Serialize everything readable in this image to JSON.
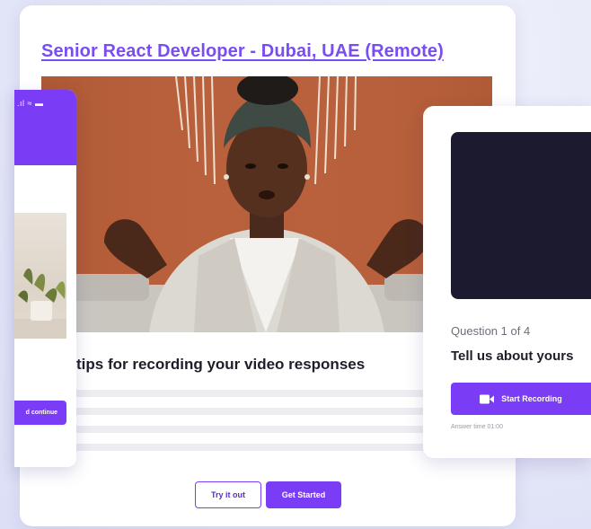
{
  "main_card": {
    "job_title": "Senior React Developer - Dubai, UAE (Remote)",
    "tips_title": "tips for recording your video responses",
    "try_button": "Try it out",
    "start_button": "Get Started"
  },
  "phone_card": {
    "status": ".ıl ≈ ▬",
    "continue_button": "d continue"
  },
  "question_card": {
    "question_count": "Question 1 of 4",
    "question_text": "Tell us about yours",
    "record_button": "Start Recording",
    "record_icon": "video-camera-icon",
    "answer_time": "Answer time 01:00"
  },
  "colors": {
    "accent": "#7b3cf5",
    "title_link": "#7a4cf4",
    "video_bg": "#1b1a2f",
    "page_bg": "#e6e7f8"
  }
}
